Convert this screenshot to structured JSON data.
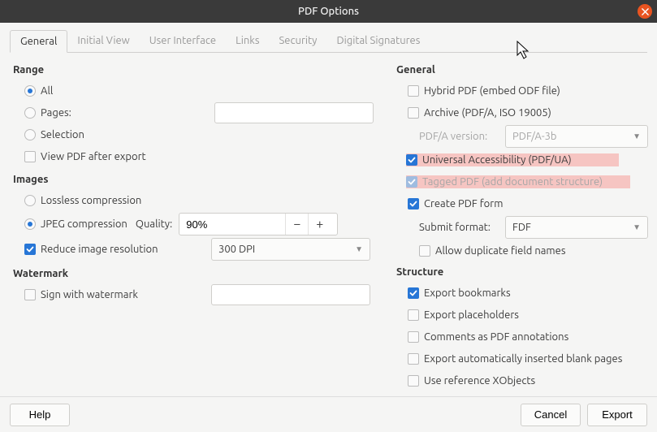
{
  "title": "PDF Options",
  "tabs": [
    "General",
    "Initial View",
    "User Interface",
    "Links",
    "Security",
    "Digital Signatures"
  ],
  "left": {
    "range": {
      "title": "Range",
      "all": "All",
      "pages": "Pages:",
      "pages_value": "",
      "selection": "Selection",
      "view_after": "View PDF after export"
    },
    "images": {
      "title": "Images",
      "lossless": "Lossless compression",
      "jpeg": "JPEG compression",
      "quality_label": "Quality:",
      "quality_value": "90%",
      "reduce": "Reduce image resolution",
      "dpi_value": "300 DPI"
    },
    "watermark": {
      "title": "Watermark",
      "sign": "Sign with watermark",
      "text_value": ""
    }
  },
  "right": {
    "general": {
      "title": "General",
      "hybrid": "Hybrid PDF (embed ODF file)",
      "archive": "Archive (PDF/A, ISO 19005)",
      "pdfa_label": "PDF/A version:",
      "pdfa_value": "PDF/A-3b",
      "ua": "Universal Accessibility (PDF/UA)",
      "tagged": "Tagged PDF (add document structure)",
      "create_form": "Create PDF form",
      "submit_label": "Submit format:",
      "submit_value": "FDF",
      "allow_dup": "Allow duplicate field names"
    },
    "structure": {
      "title": "Structure",
      "bookmarks": "Export bookmarks",
      "placeholders": "Export placeholders",
      "comments": "Comments as PDF annotations",
      "blank": "Export automatically inserted blank pages",
      "xobjects": "Use reference XObjects"
    }
  },
  "footer": {
    "help": "Help",
    "cancel": "Cancel",
    "export": "Export"
  }
}
